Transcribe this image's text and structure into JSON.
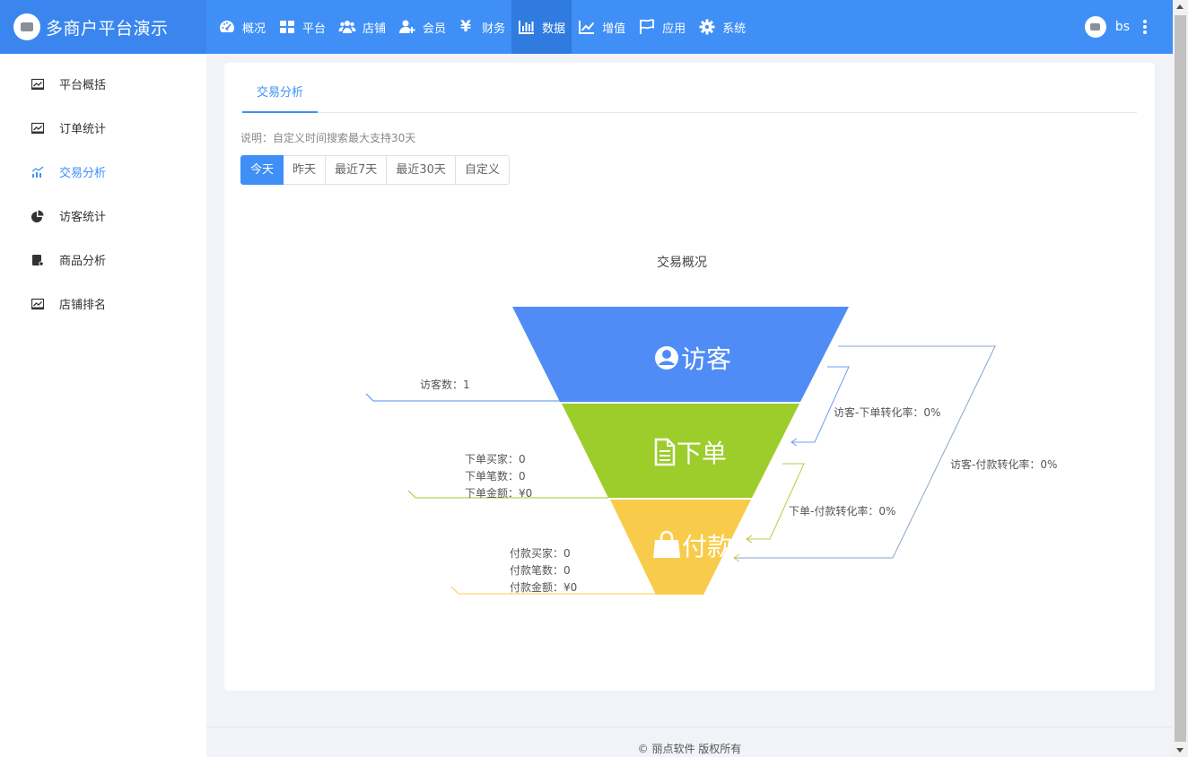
{
  "header": {
    "brand": "多商户平台演示",
    "nav": [
      {
        "label": "概况",
        "icon": "dashboard-icon"
      },
      {
        "label": "平台",
        "icon": "grid-icon"
      },
      {
        "label": "店铺",
        "icon": "users-icon"
      },
      {
        "label": "会员",
        "icon": "user-plus-icon"
      },
      {
        "label": "财务",
        "icon": "yen-icon"
      },
      {
        "label": "数据",
        "icon": "bar-chart-icon"
      },
      {
        "label": "增值",
        "icon": "line-chart-icon"
      },
      {
        "label": "应用",
        "icon": "flag-icon"
      },
      {
        "label": "系统",
        "icon": "gear-icon"
      }
    ],
    "active_nav": "数据",
    "username": "bs",
    "yen_symbol": "¥"
  },
  "sidebar": {
    "items": [
      {
        "label": "平台概括",
        "icon": "line-chart-icon"
      },
      {
        "label": "订单统计",
        "icon": "line-chart-icon"
      },
      {
        "label": "交易分析",
        "icon": "trend-chart-icon"
      },
      {
        "label": "访客统计",
        "icon": "pie-chart-icon"
      },
      {
        "label": "商品分析",
        "icon": "goods-icon"
      },
      {
        "label": "店铺排名",
        "icon": "line-chart-icon"
      }
    ],
    "active": "交易分析"
  },
  "main": {
    "tab": "交易分析",
    "hint": "说明：自定义时间搜索最大支持30天",
    "ranges": [
      "今天",
      "昨天",
      "最近7天",
      "最近30天",
      "自定义"
    ],
    "active_range": "今天"
  },
  "chart_data": {
    "type": "funnel",
    "title": "交易概况",
    "stages": [
      {
        "name": "访客",
        "color": "#4f8cf6",
        "icon": "user-circle-icon"
      },
      {
        "name": "下单",
        "color": "#9ccd2b",
        "icon": "document-icon"
      },
      {
        "name": "付款",
        "color": "#f8cc4a",
        "icon": "shopping-bag-icon"
      }
    ],
    "left_labels": [
      [
        "访客数：1"
      ],
      [
        "下单买家：0",
        "下单笔数：0",
        "下单金额：¥0"
      ],
      [
        "付款买家：0",
        "付款笔数：0",
        "付款金额：¥0"
      ]
    ],
    "conversions": [
      {
        "label": "访客-下单转化率：0%",
        "value": 0
      },
      {
        "label": "下单-付款转化率：0%",
        "value": 0
      },
      {
        "label": "访客-付款转化率：0%",
        "value": 0
      }
    ]
  },
  "footer": "© 丽点软件 版权所有"
}
